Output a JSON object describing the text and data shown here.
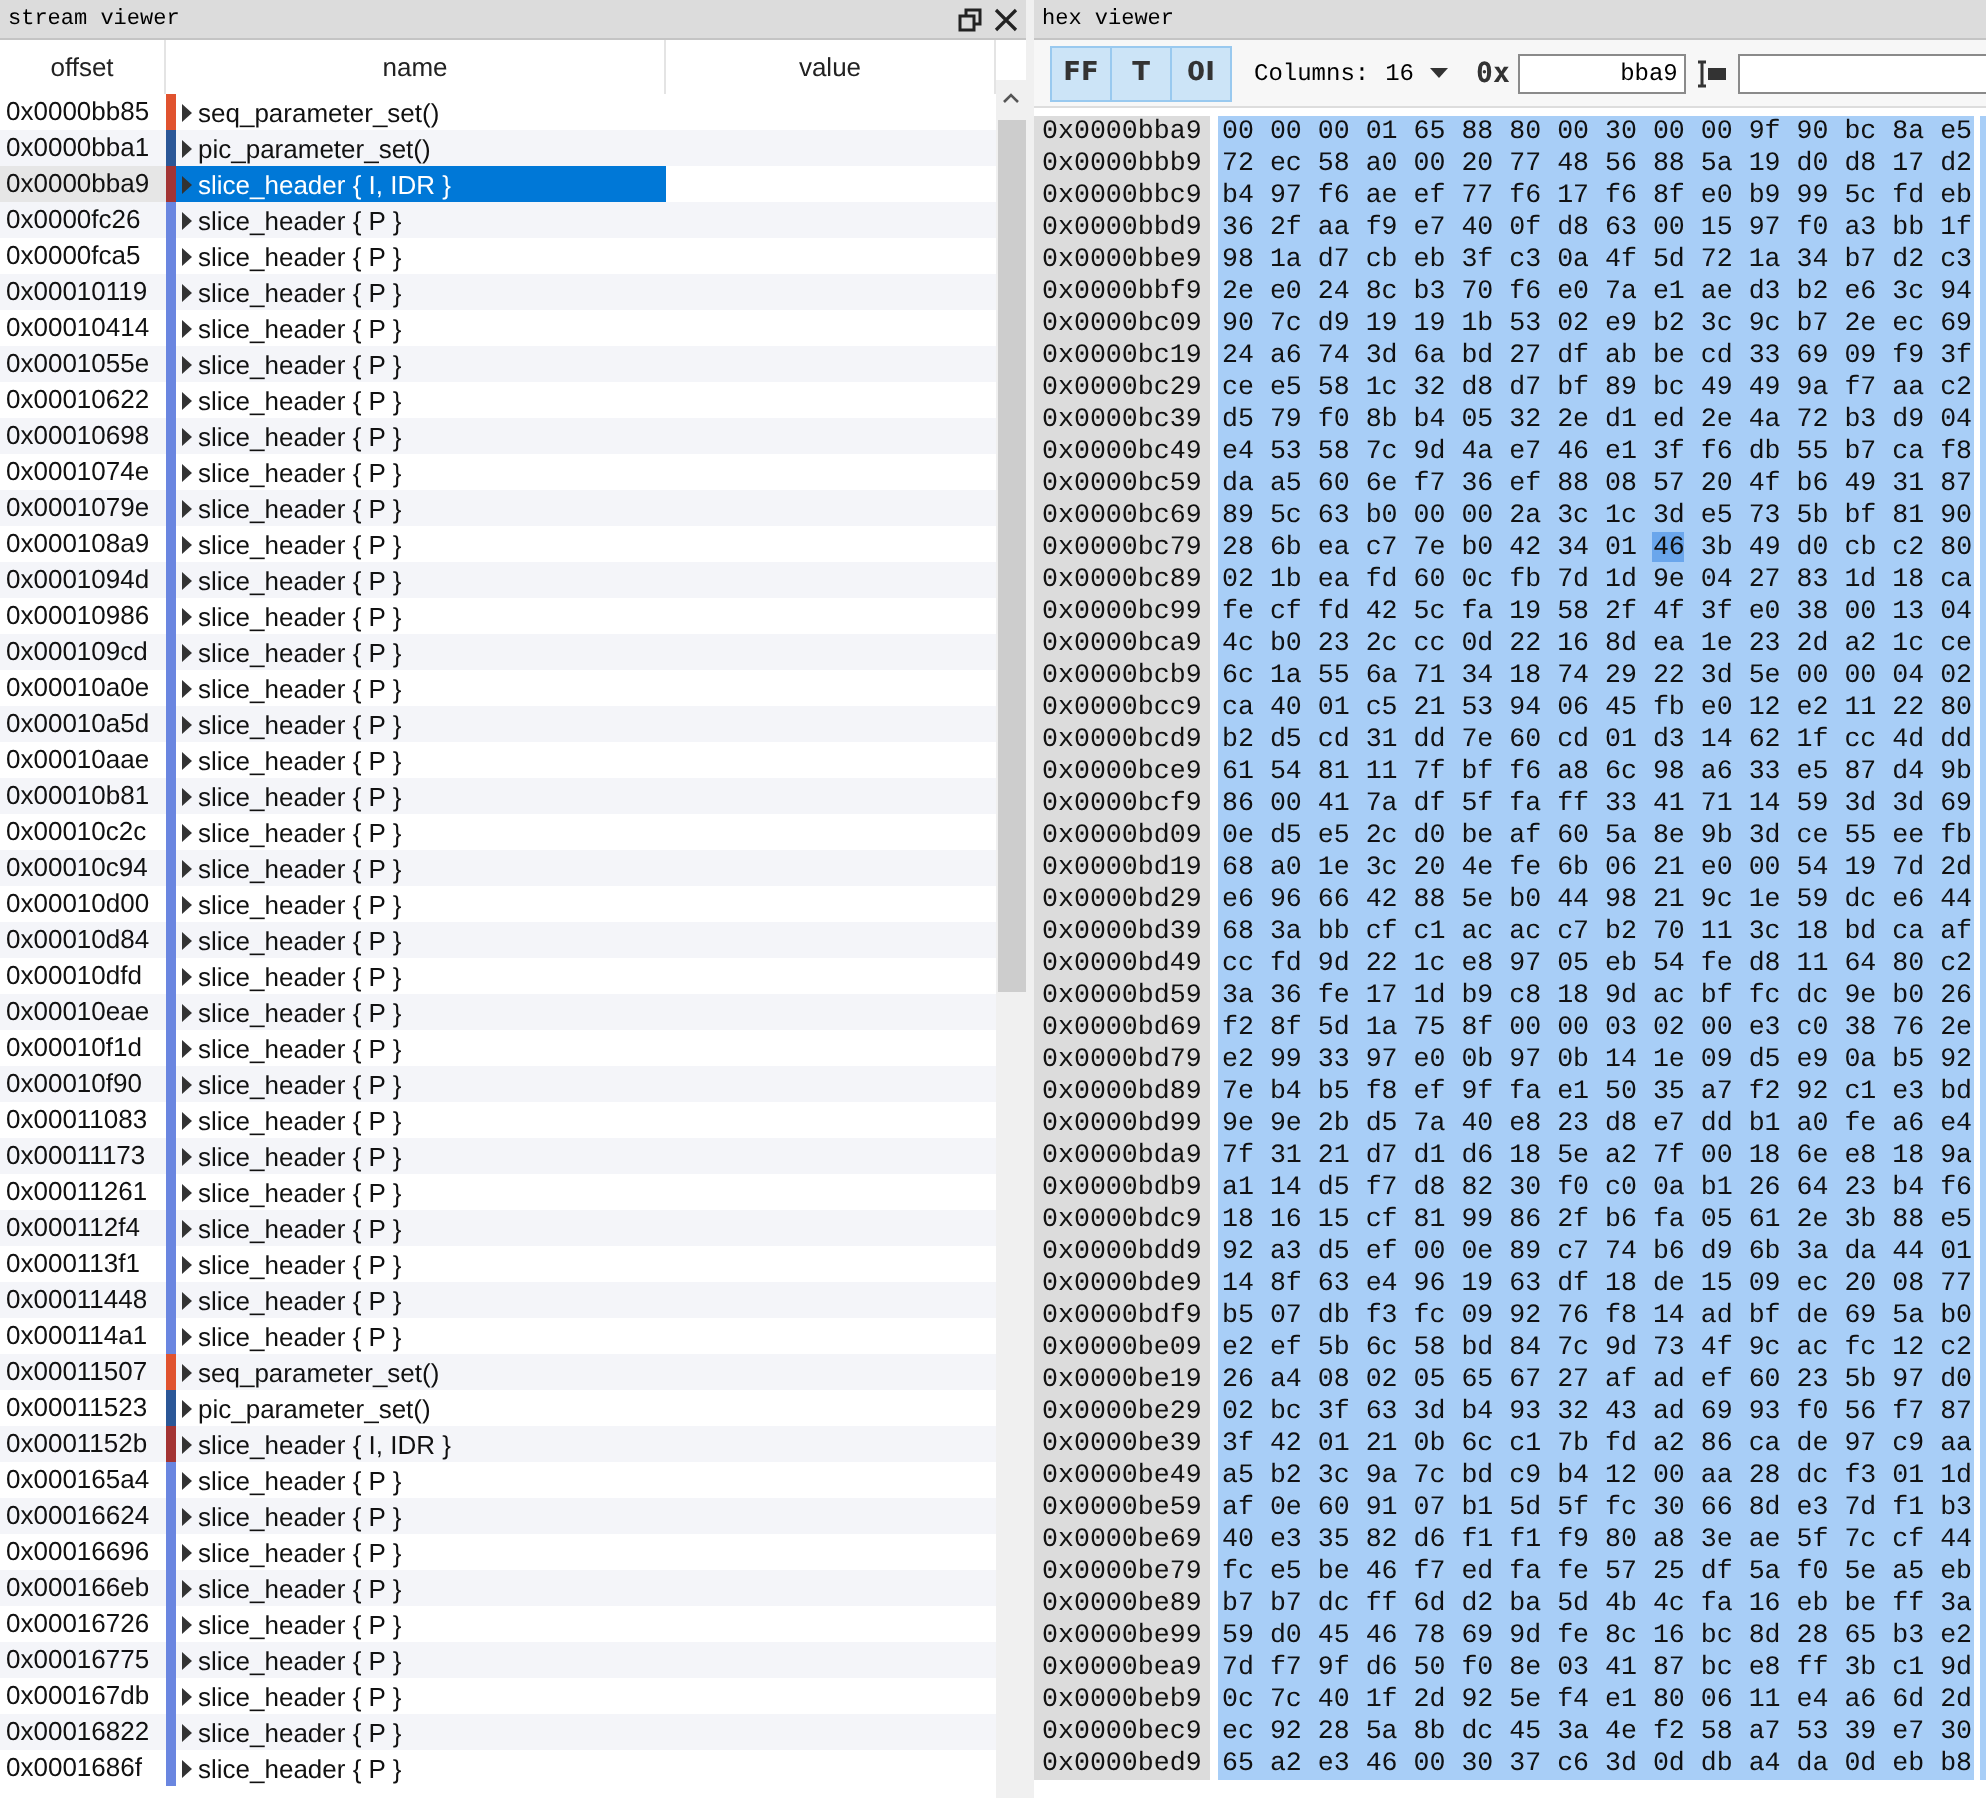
{
  "stream_viewer": {
    "title": "stream viewer",
    "columns": [
      "offset",
      "name",
      "value"
    ],
    "rows": [
      {
        "offset": "0x0000bb85",
        "name": "seq_parameter_set()",
        "color": "#e0532f",
        "selected": false
      },
      {
        "offset": "0x0000bba1",
        "name": "pic_parameter_set()",
        "color": "#2b5797",
        "selected": false
      },
      {
        "offset": "0x0000bba9",
        "name": "slice_header { I, IDR }",
        "color": "#a33434",
        "selected": true
      },
      {
        "offset": "0x0000fc26",
        "name": "slice_header { P }",
        "color": "#6a86e0",
        "selected": false
      },
      {
        "offset": "0x0000fca5",
        "name": "slice_header { P }",
        "color": "#6a86e0",
        "selected": false
      },
      {
        "offset": "0x00010119",
        "name": "slice_header { P }",
        "color": "#6a86e0",
        "selected": false
      },
      {
        "offset": "0x00010414",
        "name": "slice_header { P }",
        "color": "#6a86e0",
        "selected": false
      },
      {
        "offset": "0x0001055e",
        "name": "slice_header { P }",
        "color": "#6a86e0",
        "selected": false
      },
      {
        "offset": "0x00010622",
        "name": "slice_header { P }",
        "color": "#6a86e0",
        "selected": false
      },
      {
        "offset": "0x00010698",
        "name": "slice_header { P }",
        "color": "#6a86e0",
        "selected": false
      },
      {
        "offset": "0x0001074e",
        "name": "slice_header { P }",
        "color": "#6a86e0",
        "selected": false
      },
      {
        "offset": "0x0001079e",
        "name": "slice_header { P }",
        "color": "#6a86e0",
        "selected": false
      },
      {
        "offset": "0x000108a9",
        "name": "slice_header { P }",
        "color": "#6a86e0",
        "selected": false
      },
      {
        "offset": "0x0001094d",
        "name": "slice_header { P }",
        "color": "#6a86e0",
        "selected": false
      },
      {
        "offset": "0x00010986",
        "name": "slice_header { P }",
        "color": "#6a86e0",
        "selected": false
      },
      {
        "offset": "0x000109cd",
        "name": "slice_header { P }",
        "color": "#6a86e0",
        "selected": false
      },
      {
        "offset": "0x00010a0e",
        "name": "slice_header { P }",
        "color": "#6a86e0",
        "selected": false
      },
      {
        "offset": "0x00010a5d",
        "name": "slice_header { P }",
        "color": "#6a86e0",
        "selected": false
      },
      {
        "offset": "0x00010aae",
        "name": "slice_header { P }",
        "color": "#6a86e0",
        "selected": false
      },
      {
        "offset": "0x00010b81",
        "name": "slice_header { P }",
        "color": "#6a86e0",
        "selected": false
      },
      {
        "offset": "0x00010c2c",
        "name": "slice_header { P }",
        "color": "#6a86e0",
        "selected": false
      },
      {
        "offset": "0x00010c94",
        "name": "slice_header { P }",
        "color": "#6a86e0",
        "selected": false
      },
      {
        "offset": "0x00010d00",
        "name": "slice_header { P }",
        "color": "#6a86e0",
        "selected": false
      },
      {
        "offset": "0x00010d84",
        "name": "slice_header { P }",
        "color": "#6a86e0",
        "selected": false
      },
      {
        "offset": "0x00010dfd",
        "name": "slice_header { P }",
        "color": "#6a86e0",
        "selected": false
      },
      {
        "offset": "0x00010eae",
        "name": "slice_header { P }",
        "color": "#6a86e0",
        "selected": false
      },
      {
        "offset": "0x00010f1d",
        "name": "slice_header { P }",
        "color": "#6a86e0",
        "selected": false
      },
      {
        "offset": "0x00010f90",
        "name": "slice_header { P }",
        "color": "#6a86e0",
        "selected": false
      },
      {
        "offset": "0x00011083",
        "name": "slice_header { P }",
        "color": "#6a86e0",
        "selected": false
      },
      {
        "offset": "0x00011173",
        "name": "slice_header { P }",
        "color": "#6a86e0",
        "selected": false
      },
      {
        "offset": "0x00011261",
        "name": "slice_header { P }",
        "color": "#6a86e0",
        "selected": false
      },
      {
        "offset": "0x000112f4",
        "name": "slice_header { P }",
        "color": "#6a86e0",
        "selected": false
      },
      {
        "offset": "0x000113f1",
        "name": "slice_header { P }",
        "color": "#6a86e0",
        "selected": false
      },
      {
        "offset": "0x00011448",
        "name": "slice_header { P }",
        "color": "#6a86e0",
        "selected": false
      },
      {
        "offset": "0x000114a1",
        "name": "slice_header { P }",
        "color": "#6a86e0",
        "selected": false
      },
      {
        "offset": "0x00011507",
        "name": "seq_parameter_set()",
        "color": "#e0532f",
        "selected": false
      },
      {
        "offset": "0x00011523",
        "name": "pic_parameter_set()",
        "color": "#2b5797",
        "selected": false
      },
      {
        "offset": "0x0001152b",
        "name": "slice_header { I, IDR }",
        "color": "#a33434",
        "selected": false
      },
      {
        "offset": "0x000165a4",
        "name": "slice_header { P }",
        "color": "#6a86e0",
        "selected": false
      },
      {
        "offset": "0x00016624",
        "name": "slice_header { P }",
        "color": "#6a86e0",
        "selected": false
      },
      {
        "offset": "0x00016696",
        "name": "slice_header { P }",
        "color": "#6a86e0",
        "selected": false
      },
      {
        "offset": "0x000166eb",
        "name": "slice_header { P }",
        "color": "#6a86e0",
        "selected": false
      },
      {
        "offset": "0x00016726",
        "name": "slice_header { P }",
        "color": "#6a86e0",
        "selected": false
      },
      {
        "offset": "0x00016775",
        "name": "slice_header { P }",
        "color": "#6a86e0",
        "selected": false
      },
      {
        "offset": "0x000167db",
        "name": "slice_header { P }",
        "color": "#6a86e0",
        "selected": false
      },
      {
        "offset": "0x00016822",
        "name": "slice_header { P }",
        "color": "#6a86e0",
        "selected": false
      },
      {
        "offset": "0x0001686f",
        "name": "slice_header { P }",
        "color": "#6a86e0",
        "selected": false
      }
    ]
  },
  "hex_viewer": {
    "title": "hex viewer",
    "toolbar": {
      "toggles": [
        {
          "label": "FF",
          "pressed": true
        },
        {
          "label": "T",
          "pressed": true
        },
        {
          "label": "0I",
          "pressed": true
        }
      ],
      "columns_label": "Columns:",
      "columns_value": "16",
      "prefix": "0x",
      "address": "bba9"
    },
    "rows": [
      {
        "kind": "plain",
        "offset": "0x0000bba9",
        "bytes": "00 00 00 01 65 88 80 00 30 00 00 9f 90 bc 8a e5"
      },
      {
        "kind": "plain",
        "offset": "0x0000bbb9",
        "bytes": "72 ec 58 a0 00 20 77 48 56 88 5a 19 d0 d8 17 d2"
      },
      {
        "kind": "plain",
        "offset": "0x0000bbc9",
        "bytes": "b4 97 f6 ae ef 77 f6 17 f6 8f e0 b9 99 5c fd eb"
      },
      {
        "kind": "plain",
        "offset": "0x0000bbd9",
        "bytes": "36 2f aa f9 e7 40 0f d8 63 00 15 97 f0 a3 bb 1f"
      },
      {
        "kind": "plain",
        "offset": "0x0000bbe9",
        "bytes": "98 1a d7 cb eb 3f c3 0a 4f 5d 72 1a 34 b7 d2 c3"
      },
      {
        "kind": "plain",
        "offset": "0x0000bbf9",
        "bytes": "2e e0 24 8c b3 70 f6 e0 7a e1 ae d3 b2 e6 3c 94"
      },
      {
        "kind": "plain",
        "offset": "0x0000bc09",
        "bytes": "90 7c d9 19 19 1b 53 02 e9 b2 3c 9c b7 2e ec 69"
      },
      {
        "kind": "plain",
        "offset": "0x0000bc19",
        "bytes": "24 a6 74 3d 6a bd 27 df ab be cd 33 69 09 f9 3f"
      },
      {
        "kind": "plain",
        "offset": "0x0000bc29",
        "bytes": "ce e5 58 1c 32 d8 d7 bf 89 bc 49 49 9a f7 aa c2"
      },
      {
        "kind": "plain",
        "offset": "0x0000bc39",
        "bytes": "d5 79 f0 8b b4 05 32 2e d1 ed 2e 4a 72 b3 d9 04"
      },
      {
        "kind": "plain",
        "offset": "0x0000bc49",
        "bytes": "e4 53 58 7c 9d 4a e7 46 e1 3f f6 db 55 b7 ca f8"
      },
      {
        "kind": "plain",
        "offset": "0x0000bc59",
        "bytes": "da a5 60 6e f7 36 ef 88 08 57 20 4f b6 49 31 87"
      },
      {
        "kind": "plain",
        "offset": "0x0000bc69",
        "bytes": "89 5c 63 b0 00 00 2a 3c 1c 3d e5 73 5b bf 81 90"
      },
      {
        "kind": "cursor",
        "offset": "0x0000bc79",
        "before": "28 6b ea c7 7e b0 42 34 01",
        "byte": "46",
        "after": "3b 49 d0 cb c2 80"
      },
      {
        "kind": "plain",
        "offset": "0x0000bc89",
        "bytes": "02 1b ea fd 60 0c fb 7d 1d 9e 04 27 83 1d 18 ca"
      },
      {
        "kind": "plain",
        "offset": "0x0000bc99",
        "bytes": "fe cf fd 42 5c fa 19 58 2f 4f 3f e0 38 00 13 04"
      },
      {
        "kind": "plain",
        "offset": "0x0000bca9",
        "bytes": "4c b0 23 2c cc 0d 22 16 8d ea 1e 23 2d a2 1c ce"
      },
      {
        "kind": "plain",
        "offset": "0x0000bcb9",
        "bytes": "6c 1a 55 6a 71 34 18 74 29 22 3d 5e 00 00 04 02"
      },
      {
        "kind": "plain",
        "offset": "0x0000bcc9",
        "bytes": "ca 40 01 c5 21 53 94 06 45 fb e0 12 e2 11 22 80"
      },
      {
        "kind": "plain",
        "offset": "0x0000bcd9",
        "bytes": "b2 d5 cd 31 dd 7e 60 cd 01 d3 14 62 1f cc 4d dd"
      },
      {
        "kind": "plain",
        "offset": "0x0000bce9",
        "bytes": "61 54 81 11 7f bf f6 a8 6c 98 a6 33 e5 87 d4 9b"
      },
      {
        "kind": "plain",
        "offset": "0x0000bcf9",
        "bytes": "86 00 41 7a df 5f fa ff 33 41 71 14 59 3d 3d 69"
      },
      {
        "kind": "plain",
        "offset": "0x0000bd09",
        "bytes": "0e d5 e5 2c d0 be af 60 5a 8e 9b 3d ce 55 ee fb"
      },
      {
        "kind": "plain",
        "offset": "0x0000bd19",
        "bytes": "68 a0 1e 3c 20 4e fe 6b 06 21 e0 00 54 19 7d 2d"
      },
      {
        "kind": "plain",
        "offset": "0x0000bd29",
        "bytes": "e6 96 66 42 88 5e b0 44 98 21 9c 1e 59 dc e6 44"
      },
      {
        "kind": "plain",
        "offset": "0x0000bd39",
        "bytes": "68 3a bb cf c1 ac ac c7 b2 70 11 3c 18 bd ca af"
      },
      {
        "kind": "plain",
        "offset": "0x0000bd49",
        "bytes": "cc fd 9d 22 1c e8 97 05 eb 54 fe d8 11 64 80 c2"
      },
      {
        "kind": "plain",
        "offset": "0x0000bd59",
        "bytes": "3a 36 fe 17 1d b9 c8 18 9d ac bf fc dc 9e b0 26"
      },
      {
        "kind": "plain",
        "offset": "0x0000bd69",
        "bytes": "f2 8f 5d 1a 75 8f 00 00 03 02 00 e3 c0 38 76 2e"
      },
      {
        "kind": "plain",
        "offset": "0x0000bd79",
        "bytes": "e2 99 33 97 e0 0b 97 0b 14 1e 09 d5 e9 0a b5 92"
      },
      {
        "kind": "plain",
        "offset": "0x0000bd89",
        "bytes": "7e b4 b5 f8 ef 9f fa e1 50 35 a7 f2 92 c1 e3 bd"
      },
      {
        "kind": "plain",
        "offset": "0x0000bd99",
        "bytes": "9e 9e 2b d5 7a 40 e8 23 d8 e7 dd b1 a0 fe a6 e4"
      },
      {
        "kind": "plain",
        "offset": "0x0000bda9",
        "bytes": "7f 31 21 d7 d1 d6 18 5e a2 7f 00 18 6e e8 18 9a"
      },
      {
        "kind": "plain",
        "offset": "0x0000bdb9",
        "bytes": "a1 14 d5 f7 d8 82 30 f0 c0 0a b1 26 64 23 b4 f6"
      },
      {
        "kind": "plain",
        "offset": "0x0000bdc9",
        "bytes": "18 16 15 cf 81 99 86 2f b6 fa 05 61 2e 3b 88 e5"
      },
      {
        "kind": "plain",
        "offset": "0x0000bdd9",
        "bytes": "92 a3 d5 ef 00 0e 89 c7 74 b6 d9 6b 3a da 44 01"
      },
      {
        "kind": "plain",
        "offset": "0x0000bde9",
        "bytes": "14 8f 63 e4 96 19 63 df 18 de 15 09 ec 20 08 77"
      },
      {
        "kind": "plain",
        "offset": "0x0000bdf9",
        "bytes": "b5 07 db f3 fc 09 92 76 f8 14 ad bf de 69 5a b0"
      },
      {
        "kind": "plain",
        "offset": "0x0000be09",
        "bytes": "e2 ef 5b 6c 58 bd 84 7c 9d 73 4f 9c ac fc 12 c2"
      },
      {
        "kind": "plain",
        "offset": "0x0000be19",
        "bytes": "26 a4 08 02 05 65 67 27 af ad ef 60 23 5b 97 d0"
      },
      {
        "kind": "plain",
        "offset": "0x0000be29",
        "bytes": "02 bc 3f 63 3d b4 93 32 43 ad 69 93 f0 56 f7 87"
      },
      {
        "kind": "plain",
        "offset": "0x0000be39",
        "bytes": "3f 42 01 21 0b 6c c1 7b fd a2 86 ca de 97 c9 aa"
      },
      {
        "kind": "plain",
        "offset": "0x0000be49",
        "bytes": "a5 b2 3c 9a 7c bd c9 b4 12 00 aa 28 dc f3 01 1d"
      },
      {
        "kind": "plain",
        "offset": "0x0000be59",
        "bytes": "af 0e 60 91 07 b1 5d 5f fc 30 66 8d e3 7d f1 b3"
      },
      {
        "kind": "plain",
        "offset": "0x0000be69",
        "bytes": "40 e3 35 82 d6 f1 f1 f9 80 a8 3e ae 5f 7c cf 44"
      },
      {
        "kind": "plain",
        "offset": "0x0000be79",
        "bytes": "fc e5 be 46 f7 ed fa fe 57 25 df 5a f0 5e a5 eb"
      },
      {
        "kind": "plain",
        "offset": "0x0000be89",
        "bytes": "b7 b7 dc ff 6d d2 ba 5d 4b 4c fa 16 eb be ff 3a"
      },
      {
        "kind": "plain",
        "offset": "0x0000be99",
        "bytes": "59 d0 45 46 78 69 9d fe 8c 16 bc 8d 28 65 b3 e2"
      },
      {
        "kind": "plain",
        "offset": "0x0000bea9",
        "bytes": "7d f7 9f d6 50 f0 8e 03 41 87 bc e8 ff 3b c1 9d"
      },
      {
        "kind": "plain",
        "offset": "0x0000beb9",
        "bytes": "0c 7c 40 1f 2d 92 5e f4 e1 80 06 11 e4 a6 6d 2d"
      },
      {
        "kind": "plain",
        "offset": "0x0000bec9",
        "bytes": "ec 92 28 5a 8b dc 45 3a 4e f2 58 a7 53 39 e7 30"
      },
      {
        "kind": "plain",
        "offset": "0x0000bed9",
        "bytes": "65 a2 e3 46 00 30 37 c6 3d 0d db a4 da 0d eb b8"
      }
    ]
  }
}
